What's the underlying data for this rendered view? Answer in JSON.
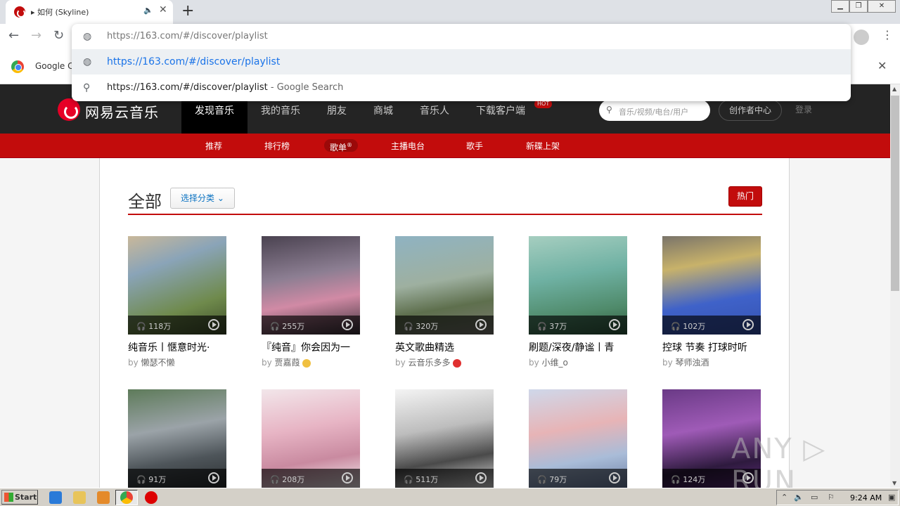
{
  "browser": {
    "tab_title": "▸ 如何 (Skyline)",
    "address": "https://163.com/#/discover/playlist",
    "suggestion_url": "https://163.com/#/discover/playlist",
    "suggestion_search_query": "https://163.com/#/discover/playlist",
    "suggestion_search_suffix": " - Google Search",
    "infobar_text": "Google Cl"
  },
  "site": {
    "logo_text": "网易云音乐",
    "top_nav": [
      "发现音乐",
      "我的音乐",
      "朋友",
      "商城",
      "音乐人",
      "下载客户端"
    ],
    "hot_badge": "HOT",
    "search_placeholder": "音乐/视频/电台/用户",
    "creator_label": "创作者中心",
    "login_label": "登录",
    "sub_nav": [
      "推荐",
      "排行榜",
      "歌单",
      "主播电台",
      "歌手",
      "新碟上架"
    ],
    "sub_nav_sup": "®"
  },
  "page": {
    "heading": "全部",
    "category_button": "选择分类",
    "hot_button": "热门"
  },
  "playlists": [
    {
      "plays": "118万",
      "name": "纯音乐丨惬意时光·",
      "by": "by",
      "author": "懒瑟不懒",
      "badge": ""
    },
    {
      "plays": "255万",
      "name": "『纯音』你会因为一",
      "by": "by",
      "author": "贾嘉葭",
      "badge": "#f0c040"
    },
    {
      "plays": "320万",
      "name": "英文歌曲精选",
      "by": "by",
      "author": "云音乐多多",
      "badge": "#e03030"
    },
    {
      "plays": "37万",
      "name": "刷题/深夜/静谧丨青",
      "by": "by",
      "author": "小维_o",
      "badge": ""
    },
    {
      "plays": "102万",
      "name": "控球 节奏 打球时听",
      "by": "by",
      "author": "琴师浊酒",
      "badge": ""
    },
    {
      "plays": "91万",
      "name": "",
      "by": "",
      "author": "",
      "badge": ""
    },
    {
      "plays": "208万",
      "name": "",
      "by": "",
      "author": "",
      "badge": ""
    },
    {
      "plays": "511万",
      "name": "",
      "by": "",
      "author": "",
      "badge": ""
    },
    {
      "plays": "79万",
      "name": "",
      "by": "",
      "author": "",
      "badge": ""
    },
    {
      "plays": "124万",
      "name": "",
      "by": "",
      "author": "",
      "badge": ""
    }
  ],
  "watermark": "ANY ▷ RUN",
  "taskbar": {
    "start_label": "Start",
    "clock": "9:24 AM"
  },
  "colors": {
    "brand_red": "#c20c0c",
    "header_dark": "#242424",
    "link_blue": "#0c73c2"
  }
}
